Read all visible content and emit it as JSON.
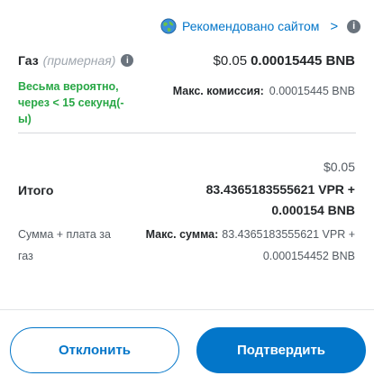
{
  "recommendation": {
    "text": "Рекомендовано сайтом",
    "chevron": ">",
    "info": "i"
  },
  "gas": {
    "label": "Газ",
    "estimated": "(примерная)",
    "info": "i",
    "fiat": "$0.05",
    "crypto": "0.00015445 BNB",
    "likely": "Весьма вероятно, через < 15 секунд(-ы)",
    "max_fee_label": "Макс. комиссия:",
    "max_fee_value": "0.00015445 BNB"
  },
  "total": {
    "label": "Итого",
    "fiat": "$0.05",
    "crypto": "83.4365183555621 VPR + 0.000154 BNB",
    "sum_label": "Сумма + плата за газ",
    "max_sum_label": "Макс. сумма:",
    "max_sum_value": "83.4365183555621 VPR + 0.000154452 BNB"
  },
  "buttons": {
    "reject": "Отклонить",
    "confirm": "Подтвердить"
  },
  "colors": {
    "primary": "#0376c9",
    "success": "#28a745",
    "text": "#24272a",
    "muted": "#535a61"
  },
  "icons": {
    "site": "globe-icon",
    "info": "info-icon"
  }
}
